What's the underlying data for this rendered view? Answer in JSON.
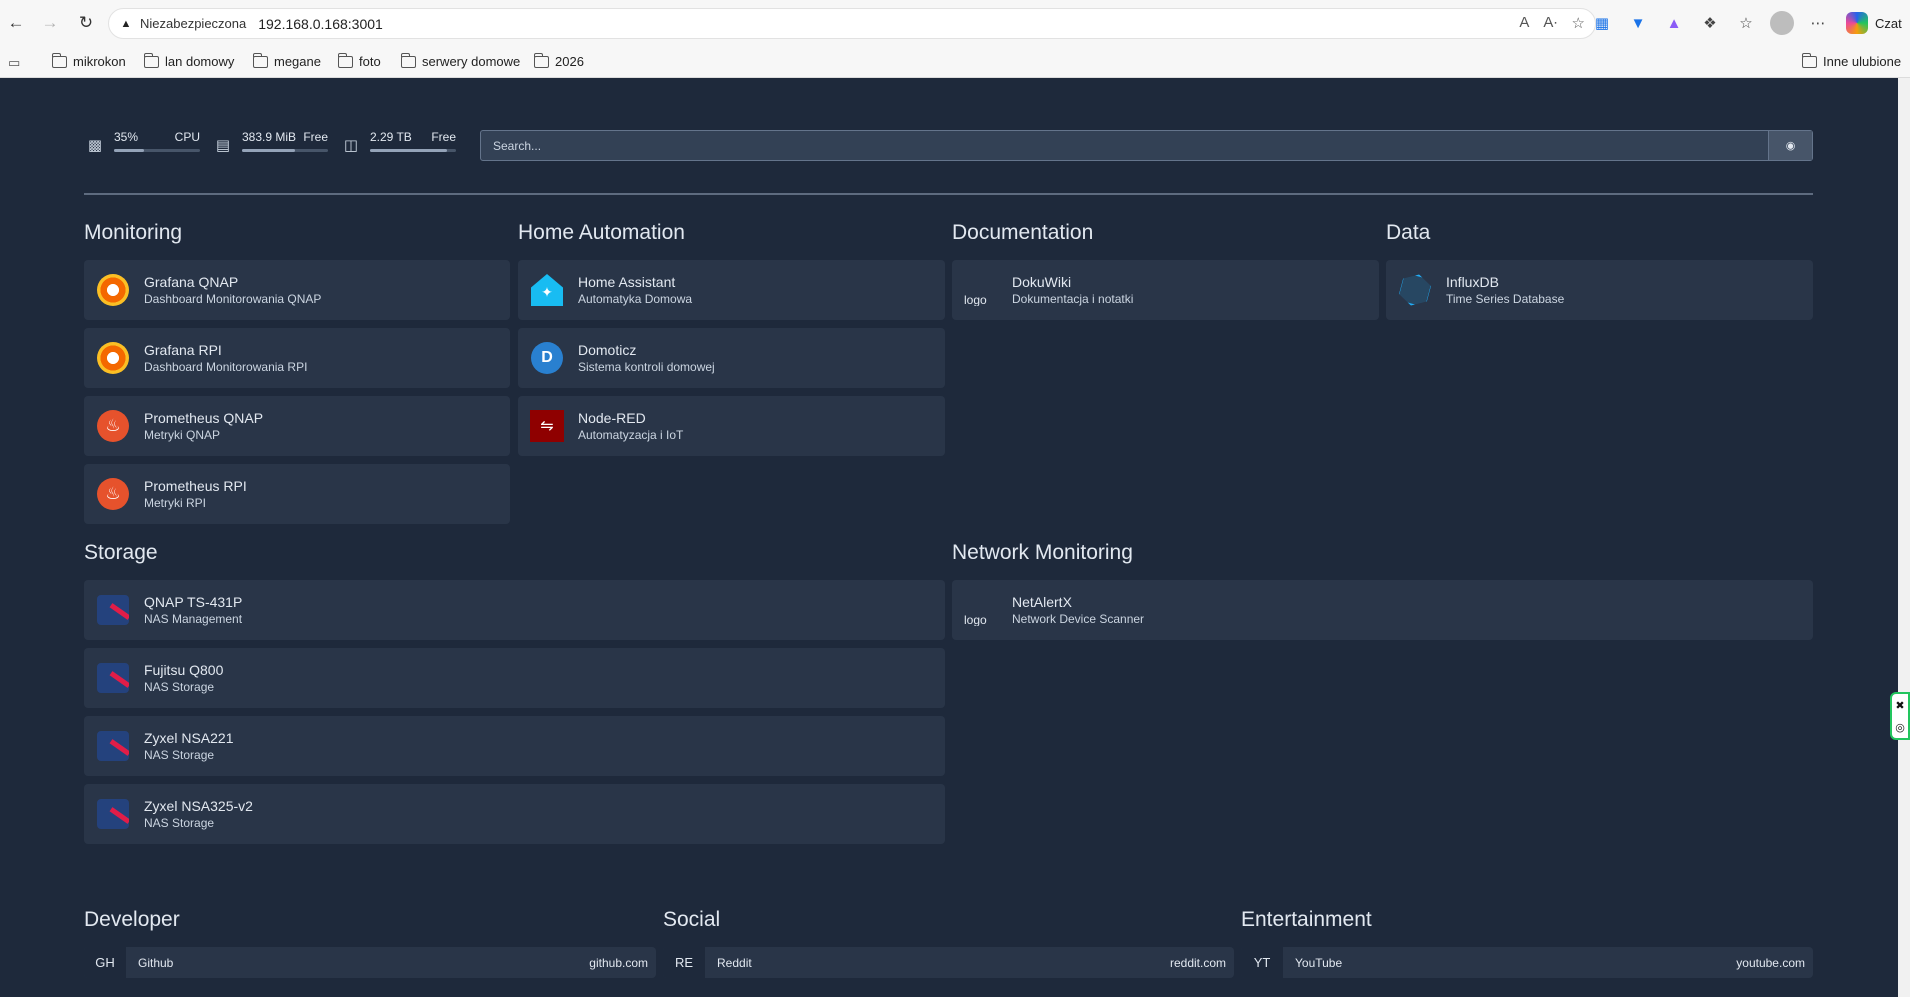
{
  "browser": {
    "security_label": "Niezabezpieczona",
    "url": "192.168.0.168:3001",
    "copilot_label": "Czat",
    "bookmarks": [
      "mikrokon",
      "lan domowy",
      "megane",
      "foto",
      "serwery domowe",
      "2026"
    ],
    "other_favorites": "Inne ulubione"
  },
  "resources": {
    "cpu": {
      "value": "35%",
      "label": "CPU",
      "usage_pct": 35
    },
    "memory": {
      "value": "383.9 MiB",
      "label": "Free",
      "usage_pct": 62
    },
    "disk": {
      "value": "2.29 TB",
      "label": "Free",
      "usage_pct": 90
    }
  },
  "search": {
    "placeholder": "Search..."
  },
  "groups": {
    "monitoring": {
      "title": "Monitoring",
      "services": [
        {
          "name": "Grafana QNAP",
          "description": "Dashboard Monitorowania QNAP"
        },
        {
          "name": "Grafana RPI",
          "description": "Dashboard Monitorowania RPI"
        },
        {
          "name": "Prometheus QNAP",
          "description": "Metryki QNAP"
        },
        {
          "name": "Prometheus RPI",
          "description": "Metryki RPI"
        }
      ]
    },
    "home_automation": {
      "title": "Home Automation",
      "services": [
        {
          "name": "Home Assistant",
          "description": "Automatyka Domowa"
        },
        {
          "name": "Domoticz",
          "description": "Sistema kontroli domowej"
        },
        {
          "name": "Node-RED",
          "description": "Automatyzacja i IoT"
        }
      ]
    },
    "documentation": {
      "title": "Documentation",
      "services": [
        {
          "name": "DokuWiki",
          "description": "Dokumentacja i notatki",
          "icon_alt": "logo"
        }
      ]
    },
    "data": {
      "title": "Data",
      "services": [
        {
          "name": "InfluxDB",
          "description": "Time Series Database"
        }
      ]
    },
    "storage": {
      "title": "Storage",
      "services": [
        {
          "name": "QNAP TS-431P",
          "description": "NAS Management"
        },
        {
          "name": "Fujitsu Q800",
          "description": "NAS Storage"
        },
        {
          "name": "Zyxel NSA221",
          "description": "NAS Storage"
        },
        {
          "name": "Zyxel NSA325-v2",
          "description": "NAS Storage"
        }
      ]
    },
    "network": {
      "title": "Network Monitoring",
      "services": [
        {
          "name": "NetAlertX",
          "description": "Network Device Scanner",
          "icon_alt": "logo"
        }
      ]
    }
  },
  "bookmark_groups": {
    "developer": {
      "title": "Developer",
      "abbr": "GH",
      "name": "Github",
      "host": "github.com"
    },
    "social": {
      "title": "Social",
      "abbr": "RE",
      "name": "Reddit",
      "host": "reddit.com"
    },
    "entertainment": {
      "title": "Entertainment",
      "abbr": "YT",
      "name": "YouTube",
      "host": "youtube.com"
    }
  }
}
